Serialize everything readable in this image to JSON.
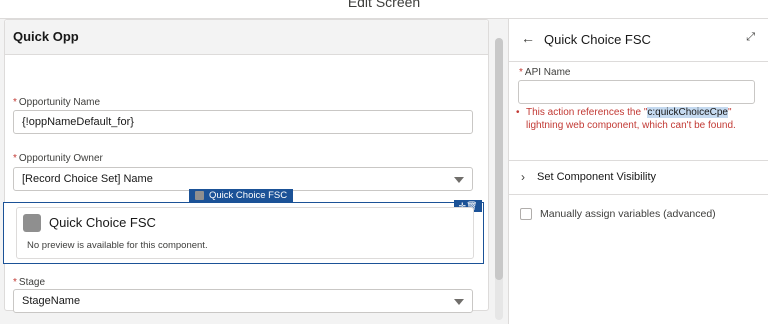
{
  "app": {
    "title": "Edit Screen"
  },
  "canvas": {
    "card_title": "Quick Opp",
    "fields": [
      {
        "label": "Opportunity Name",
        "required_mark": "*",
        "value": "{!oppNameDefault_for}"
      },
      {
        "label": "Opportunity Owner",
        "required_mark": "*",
        "value": "[Record Choice Set] Name"
      },
      {
        "label": "Stage",
        "required_mark": "*",
        "value": "StageName"
      }
    ],
    "selected_component": {
      "tag_label": "Quick Choice FSC",
      "title": "Quick Choice FSC",
      "note": "No preview is available for this component.",
      "actions": "✛🗑"
    }
  },
  "panel": {
    "back_icon": "←",
    "title": "Quick Choice FSC",
    "expand_icon": "⤢",
    "api_label": "API Name",
    "api_required_mark": "*",
    "api_value": "",
    "error": {
      "bullet": "•",
      "pre": "This action references the \"",
      "component": "c:quickChoiceCpe",
      "post": "\" lightning web component, which can't be found."
    },
    "section": {
      "chevron": "›",
      "label": "Set Component Visibility"
    },
    "checkbox": {
      "label": "Manually assign variables (advanced)",
      "checked": false
    }
  },
  "colors": {
    "selection": "#1b5297",
    "error": "#c23934",
    "highlight": "#c5daf0"
  }
}
